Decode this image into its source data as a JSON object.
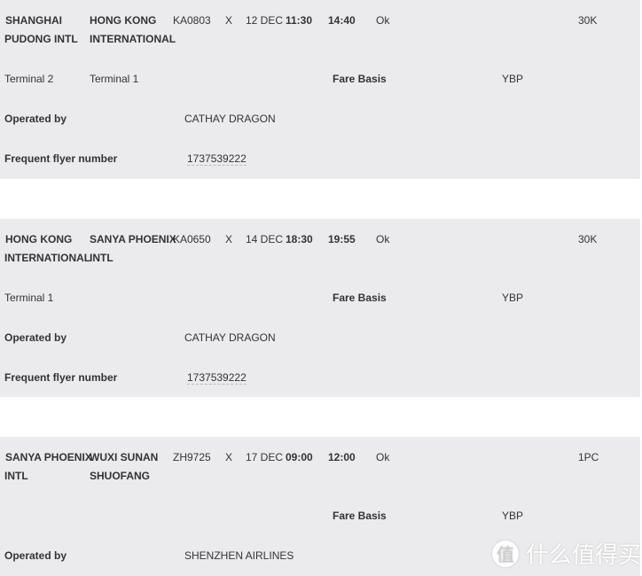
{
  "segments": [
    {
      "origin": [
        "SHANGHAI",
        "PUDONG INTL"
      ],
      "destination": [
        "HONG KONG",
        "INTERNATIONAL"
      ],
      "flight": "KA0803",
      "class": "X",
      "date": "12 DEC",
      "departure": "11:30",
      "arrival": "14:40",
      "status": "Ok",
      "baggage": "30K",
      "origin_terminal": "Terminal 2",
      "destination_terminal": "Terminal 1",
      "fare_basis_label": "Fare Basis",
      "fare_basis": "YBP",
      "operated_by_label": "Operated by",
      "operated_by": "CATHAY DRAGON",
      "ffn_label": "Frequent flyer number",
      "ffn": "1737539222"
    },
    {
      "origin": [
        "HONG KONG",
        "INTERNATIONAL"
      ],
      "destination": [
        "SANYA PHOENIX",
        "INTL"
      ],
      "flight": "KA0650",
      "class": "X",
      "date": "14 DEC",
      "departure": "18:30",
      "arrival": "19:55",
      "status": "Ok",
      "baggage": "30K",
      "origin_terminal": "Terminal 1",
      "destination_terminal": "",
      "fare_basis_label": "Fare Basis",
      "fare_basis": "YBP",
      "operated_by_label": "Operated by",
      "operated_by": "CATHAY DRAGON",
      "ffn_label": "Frequent flyer number",
      "ffn": "1737539222"
    },
    {
      "origin": [
        "SANYA PHOENIX",
        "INTL"
      ],
      "destination": [
        "WUXI SUNAN",
        "SHUOFANG"
      ],
      "flight": "ZH9725",
      "class": "X",
      "date": "17 DEC",
      "departure": "09:00",
      "arrival": "12:00",
      "status": "Ok",
      "baggage": "1PC",
      "origin_terminal": "",
      "destination_terminal": "",
      "fare_basis_label": "Fare Basis",
      "fare_basis": "YBP",
      "operated_by_label": "Operated by",
      "operated_by": "SHENZHEN AIRLINES"
    }
  ],
  "watermark": {
    "icon": "值",
    "text": "什么值得买"
  }
}
